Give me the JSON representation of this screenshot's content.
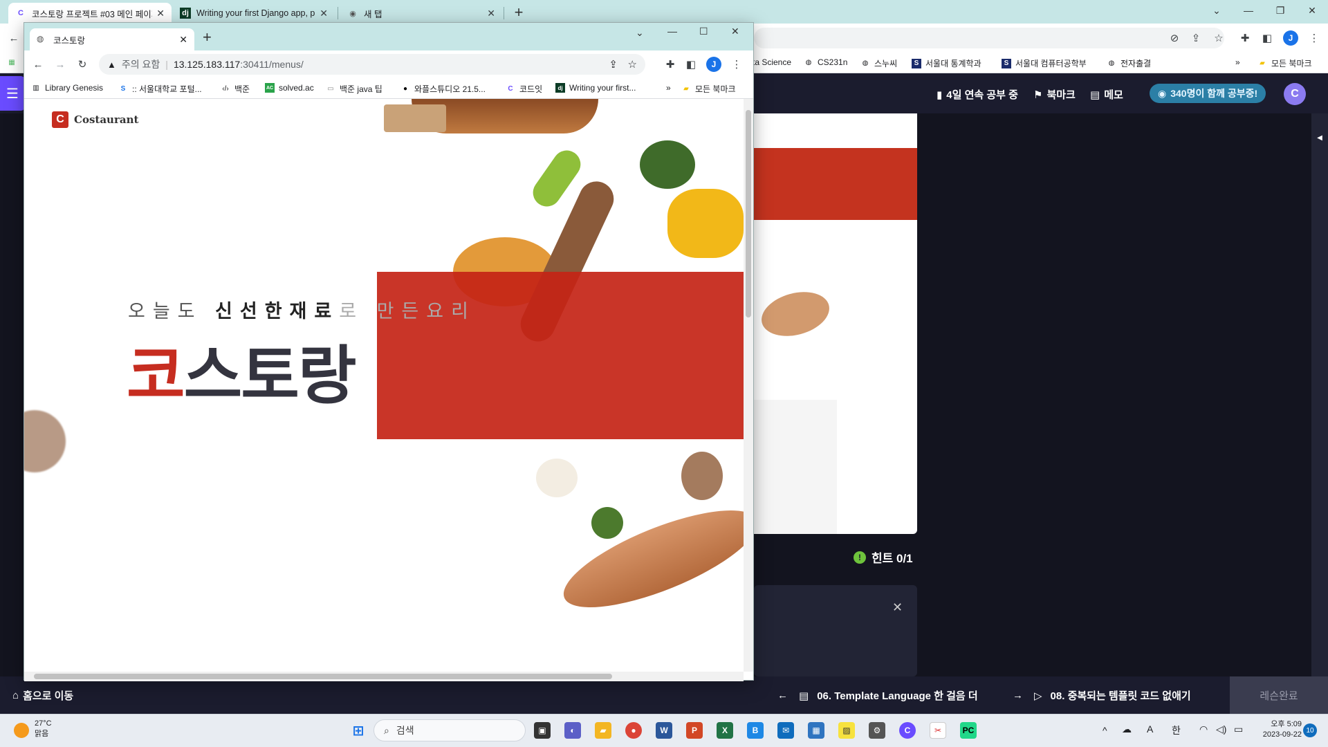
{
  "outer_browser": {
    "tabs": [
      {
        "title": "코스토랑 프로젝트 #03 메인 페이지",
        "favicon": "codeit-icon",
        "active": true
      },
      {
        "title": "Writing your first Django app, p",
        "favicon": "django-icon",
        "active": false
      },
      {
        "title": "새 탭",
        "favicon": "chrome-icon",
        "active": false
      }
    ],
    "bookmarks": [
      "ta Science",
      "CS231n",
      "스누씨",
      "서울대 통계학과",
      "서울대 컴퓨터공학부",
      "전자출결",
      "모든 북마크"
    ],
    "profile_initial": "J",
    "overflow": "»"
  },
  "inner_browser": {
    "tab_title": "코스토랑",
    "security_label": "주의 요함",
    "url_host": "13.125.183.117",
    "url_path": ":30411/menus/",
    "profile_initial": "J",
    "bookmarks": [
      "Library Genesis",
      ":: 서울대학교 포털...",
      "백준",
      "solved.ac",
      "백준 java 팁",
      "와플스튜디오 21.5...",
      "코드잇",
      "Writing your first...",
      "모든 북마크"
    ],
    "overflow": "»"
  },
  "page": {
    "logo_text": "Costaurant",
    "logo_mark": "C",
    "tagline": {
      "normal1": "오늘도 ",
      "bold": "신선한재료",
      "normal2": "로 만든요리"
    },
    "hero": {
      "red": "코",
      "rest": "스토랑"
    }
  },
  "codeit": {
    "header": {
      "streak": "4일 연속 공부 중",
      "bookmark": "북마크",
      "memo": "메모",
      "studying": "340명이 함께 공부중!"
    },
    "hint": "힌트 0/1",
    "footer": {
      "home": "홈으로 이동",
      "prev": "06. Template Language 한 걸음 더",
      "next": "08. 중복되는 템플릿 코드 없애기",
      "complete": "레슨완료"
    }
  },
  "taskbar": {
    "weather_temp": "27°C",
    "weather_desc": "맑음",
    "search_placeholder": "검색",
    "time": "오후 5:09",
    "date": "2023-09-22",
    "notifications": "10",
    "ime": "한"
  },
  "colors": {
    "brand_red": "#c62d20",
    "codeit_dark": "#1b1c2e",
    "tabstrip": "#c6e6e6"
  }
}
